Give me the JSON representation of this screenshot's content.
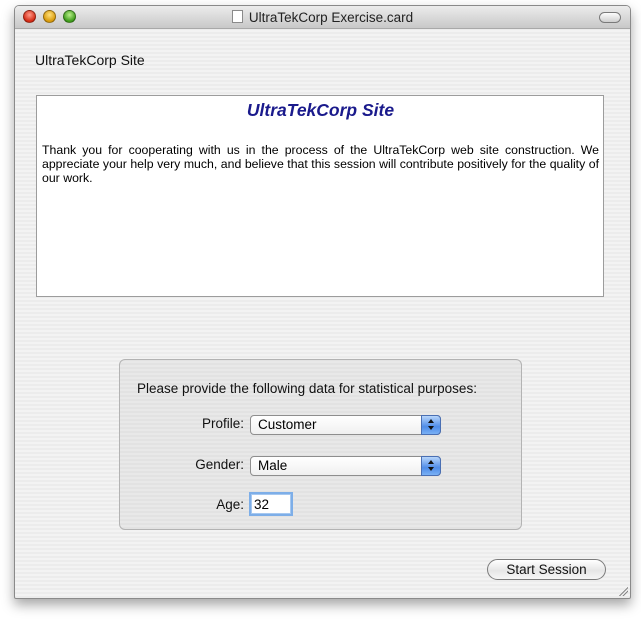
{
  "window": {
    "title": "UltraTekCorp Exercise.card"
  },
  "card": {
    "heading": "UltraTekCorp Site",
    "content": {
      "title": "UltraTekCorp Site",
      "body": "Thank you for cooperating with us in the process of the UltraTekCorp web site construction. We appreciate your help very much, and believe that this session will contribute positively for the quality of our work."
    }
  },
  "form": {
    "prompt": "Please provide the following data for statistical purposes:",
    "profile": {
      "label": "Profile:",
      "value": "Customer"
    },
    "gender": {
      "label": "Gender:",
      "value": "Male"
    },
    "age": {
      "label": "Age:",
      "value": "32"
    }
  },
  "actions": {
    "start_label": "Start Session"
  }
}
